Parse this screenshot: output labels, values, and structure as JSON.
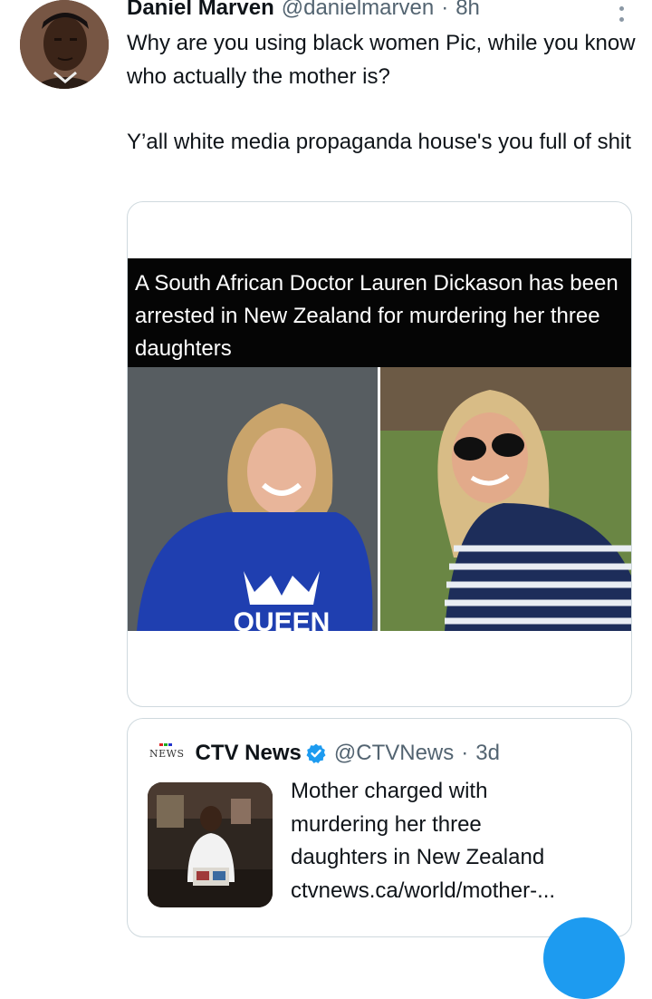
{
  "tweet": {
    "author_name": "Daniel Marven",
    "author_handle": "@danielmarven",
    "separator": "·",
    "time": "8h",
    "text_paragraph_1": "Why are you using black women Pic, while you know who actually the mother is?",
    "text_paragraph_2": "Y’all white media propaganda house's you full of shit",
    "media": {
      "caption": "A South African Doctor Lauren Dickason has been arrested in New Zealand for murdering her three daughters",
      "shirt_text": "QUEEN"
    }
  },
  "quote": {
    "logo_text": "NEWS",
    "author_name": "CTV News",
    "author_handle": "@CTVNews",
    "separator": "·",
    "time": "3d",
    "title_lines": [
      "Mother charged with",
      "murdering her three",
      "daughters in New Zealand",
      "ctvnews.ca/world/mother-..."
    ]
  },
  "colors": {
    "text_primary": "#0f1419",
    "text_secondary": "#536471",
    "border": "#cfd9de",
    "verified_blue": "#1d9bf0",
    "banner_black": "#050505"
  },
  "icons": {
    "more": "more-dots-icon",
    "verified": "verified-badge-icon"
  }
}
